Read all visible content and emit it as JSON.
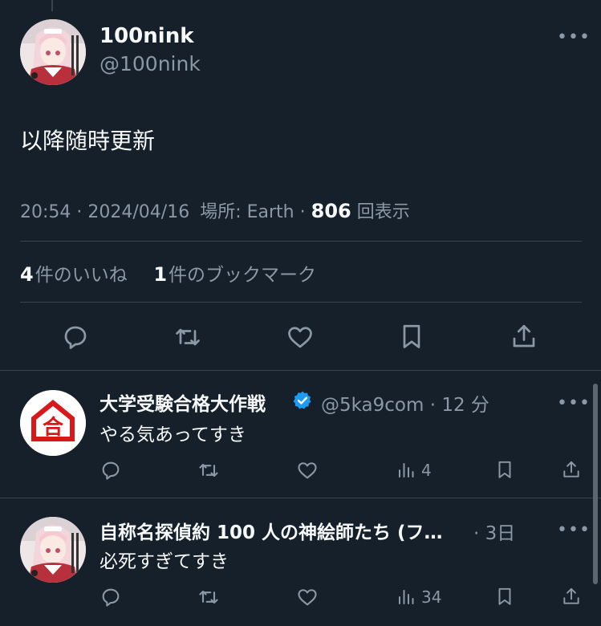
{
  "main_tweet": {
    "author_name": "100nink",
    "author_handle": "@100nink",
    "text": "以降随時更新",
    "time": "20:54",
    "date": "2024/04/16",
    "location_label": "場所: Earth",
    "views": "806",
    "views_label": "回表示",
    "likes_count": "4",
    "likes_label": "件のいいね",
    "bookmarks_count": "1",
    "bookmarks_label": "件のブックマーク"
  },
  "replies": [
    {
      "author_name": "大学受験合格大作戦",
      "verified": true,
      "author_handle": "@5ka9com",
      "time": "12 分",
      "text": "やる気あってすき",
      "views": "4",
      "avatar_char": "合"
    },
    {
      "author_name": "自称名探偵約 100 人の神絵師たち (フ…",
      "verified": false,
      "author_handle": "",
      "time": "3日",
      "text": "必死すぎてすき",
      "views": "34"
    }
  ],
  "icons": {
    "reply": "reply-icon",
    "retweet": "retweet-icon",
    "like": "heart-icon",
    "bookmark": "bookmark-icon",
    "share": "share-icon",
    "views": "views-chart-icon",
    "more": "more-dots-icon",
    "verified": "verified-badge-icon"
  },
  "colors": {
    "background": "#15202b",
    "text": "#f7f9f9",
    "secondary": "#8b98a5",
    "divider": "#38444d",
    "verified": "#1d9bf0",
    "badge_red": "#d7191c"
  }
}
